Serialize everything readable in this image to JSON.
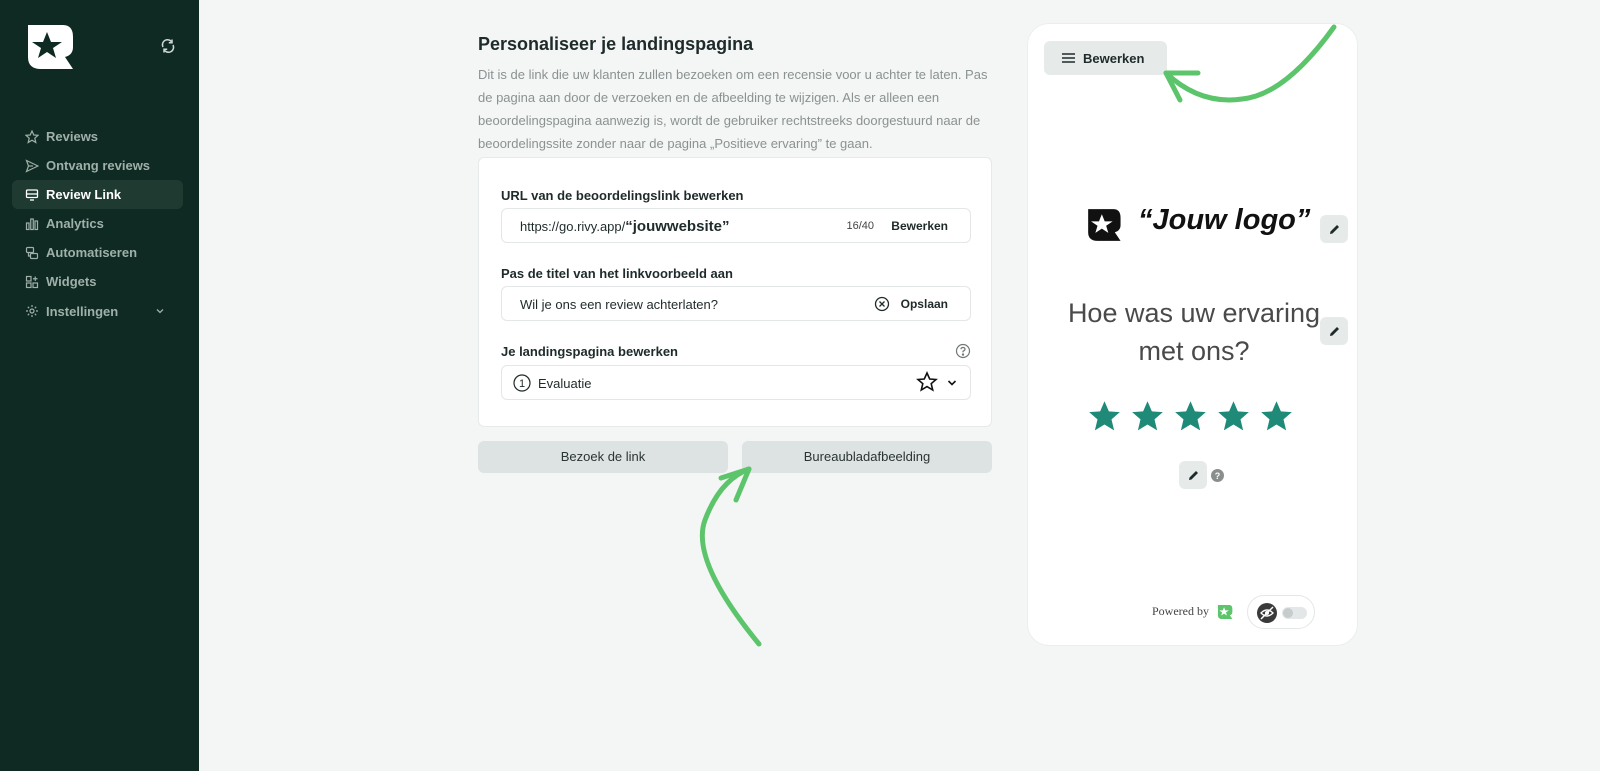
{
  "sidebar": {
    "items": [
      {
        "label": "Reviews",
        "icon": "star-icon"
      },
      {
        "label": "Ontvang reviews",
        "icon": "send-icon"
      },
      {
        "label": "Review Link",
        "icon": "monitor-icon",
        "active": true
      },
      {
        "label": "Analytics",
        "icon": "bar-chart-icon"
      },
      {
        "label": "Automatiseren",
        "icon": "automation-icon"
      },
      {
        "label": "Widgets",
        "icon": "widgets-icon"
      },
      {
        "label": "Instellingen",
        "icon": "gear-icon"
      }
    ]
  },
  "main": {
    "title": "Personaliseer je landingspagina",
    "description": "Dit is de link die uw klanten zullen bezoeken om een recensie voor u achter te laten. Pas de pagina aan door de verzoeken en de afbeelding te wijzigen. Als er alleen een beoordelingspagina aanwezig is, wordt de gebruiker rechtstreeks doorgestuurd naar de beoordelingssite zonder naar de pagina „Positieve ervaring” te gaan.",
    "url_field": {
      "label": "URL van de beoordelingslink bewerken",
      "prefix": "https://go.rivy.app/",
      "slug": "“jouwwebsite”",
      "counter": "16/40",
      "button": "Bewerken"
    },
    "title_field": {
      "label": "Pas de titel van het linkvoorbeeld aan",
      "value": "Wil je ons een review achterlaten?",
      "button": "Opslaan"
    },
    "landing_field": {
      "label": "Je landingspagina bewerken",
      "step_number": "1",
      "value": "Evaluatie"
    },
    "buttons": {
      "visit": "Bezoek de link",
      "wallpaper": "Bureaubladafbeelding"
    }
  },
  "preview": {
    "edit_button": "Bewerken",
    "logo_text": "“Jouw logo”",
    "question": "Hoe was uw ervaring met ons?",
    "stars": 5,
    "powered_by": "Powered by"
  },
  "colors": {
    "sidebar_bg": "#0f2a22",
    "accent": "#1f8a78",
    "arrow": "#5cc46a"
  }
}
